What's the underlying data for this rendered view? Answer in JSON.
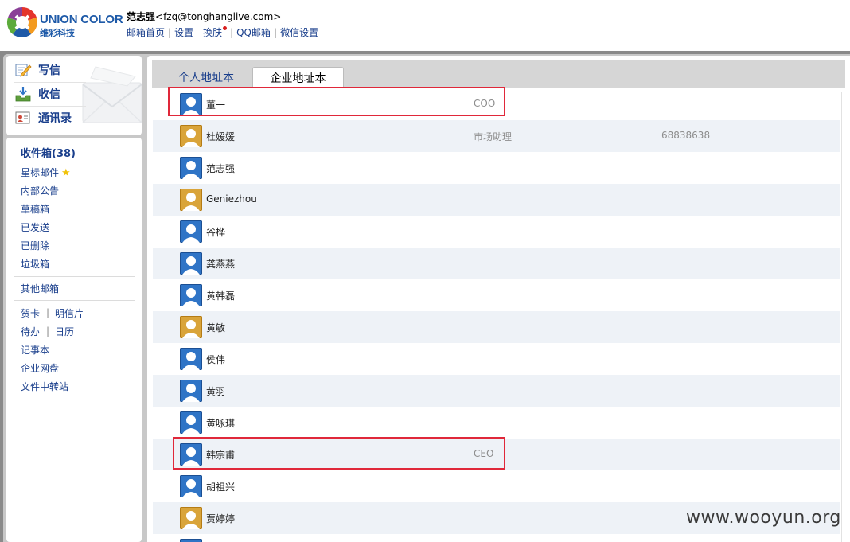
{
  "logo": {
    "name": "UNION COLOR",
    "subtitle": "维彩科技"
  },
  "user": {
    "name": "范志强",
    "email": "<fzq@tonghanglive.com>"
  },
  "nav": [
    "邮箱首页",
    "设置",
    "换肤",
    "QQ邮箱",
    "微信设置"
  ],
  "quick": {
    "write": "写信",
    "receive": "收信",
    "contacts": "通讯录"
  },
  "folders": {
    "inbox": "收件箱(38)",
    "starred": "星标邮件",
    "announcements": "内部公告",
    "drafts": "草稿箱",
    "sent": "已发送",
    "deleted": "已删除",
    "trash": "垃圾箱",
    "other": "其他邮箱",
    "cards": "贺卡",
    "postcards": "明信片",
    "todo": "待办",
    "calendar": "日历",
    "notes": "记事本",
    "disk": "企业网盘",
    "transfer": "文件中转站"
  },
  "tabs": {
    "personal": "个人地址本",
    "enterprise": "企业地址本"
  },
  "contacts": [
    {
      "name": "董一",
      "title": "COO",
      "phone": "",
      "avatar": "blue"
    },
    {
      "name": "杜媛媛",
      "title": "市场助理",
      "phone": "68838638",
      "avatar": "gold"
    },
    {
      "name": "范志强",
      "title": "",
      "phone": "",
      "avatar": "blue"
    },
    {
      "name": "Geniezhou",
      "title": "",
      "phone": "",
      "avatar": "gold"
    },
    {
      "name": "谷桦",
      "title": "",
      "phone": "",
      "avatar": "blue"
    },
    {
      "name": "龚燕燕",
      "title": "",
      "phone": "",
      "avatar": "blue"
    },
    {
      "name": "黄韩磊",
      "title": "",
      "phone": "",
      "avatar": "blue"
    },
    {
      "name": "黄敏",
      "title": "",
      "phone": "",
      "avatar": "gold"
    },
    {
      "name": "侯伟",
      "title": "",
      "phone": "",
      "avatar": "blue"
    },
    {
      "name": "黄羽",
      "title": "",
      "phone": "",
      "avatar": "blue"
    },
    {
      "name": "黄咏琪",
      "title": "",
      "phone": "",
      "avatar": "blue"
    },
    {
      "name": "韩宗甫",
      "title": "CEO",
      "phone": "",
      "avatar": "blue"
    },
    {
      "name": "胡祖兴",
      "title": "",
      "phone": "",
      "avatar": "blue"
    },
    {
      "name": "贾婷婷",
      "title": "",
      "phone": "",
      "avatar": "gold"
    },
    {
      "name": "",
      "title": "",
      "phone": "",
      "avatar": "blue"
    }
  ],
  "watermark": "www.wooyun.org",
  "colors": {
    "link": "#1a3f8c",
    "highlight": "#e0283a",
    "alt_row": "#eef2f7",
    "avatar_blue": "#2f74c6",
    "avatar_gold": "#d9a43a"
  }
}
